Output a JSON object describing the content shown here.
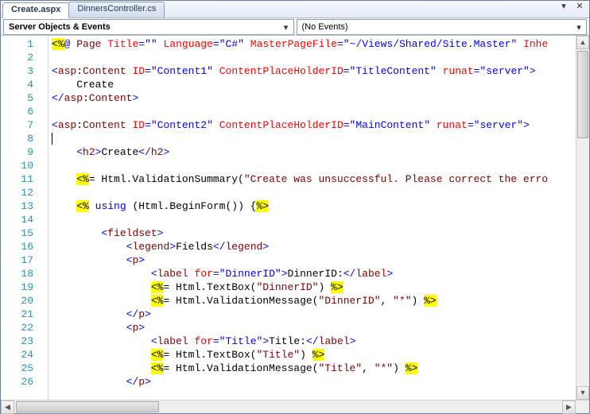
{
  "tabs": {
    "active": "Create.aspx",
    "inactive": "DinnersController.cs"
  },
  "window_controls": {
    "dropdown": "▾",
    "close": "✕"
  },
  "toolbar": {
    "left": {
      "label": "Server Objects & Events",
      "arrow": "▾"
    },
    "right": {
      "label": "(No Events)",
      "arrow": "▾"
    }
  },
  "line_start": 1,
  "line_end": 26,
  "code_lines": [
    [
      [
        "hl",
        "<%"
      ],
      [
        "kw",
        "@ "
      ],
      [
        "tag",
        "Page"
      ],
      [
        "txt",
        " "
      ],
      [
        "attr",
        "Title"
      ],
      [
        "delim",
        "=\""
      ],
      [
        "str",
        ""
      ],
      [
        "delim",
        "\""
      ],
      [
        "txt",
        " "
      ],
      [
        "attr",
        "Language"
      ],
      [
        "delim",
        "=\""
      ],
      [
        "str",
        "C#"
      ],
      [
        "delim",
        "\""
      ],
      [
        "txt",
        " "
      ],
      [
        "attr",
        "MasterPageFile"
      ],
      [
        "delim",
        "=\""
      ],
      [
        "str",
        "~/Views/Shared/Site.Master"
      ],
      [
        "delim",
        "\""
      ],
      [
        "txt",
        " "
      ],
      [
        "attr",
        "Inhe"
      ]
    ],
    [],
    [
      [
        "delim",
        "<"
      ],
      [
        "tag",
        "asp"
      ],
      [
        "txt",
        ":"
      ],
      [
        "tag",
        "Content"
      ],
      [
        "txt",
        " "
      ],
      [
        "attr",
        "ID"
      ],
      [
        "delim",
        "=\""
      ],
      [
        "str",
        "Content1"
      ],
      [
        "delim",
        "\""
      ],
      [
        "txt",
        " "
      ],
      [
        "attr",
        "ContentPlaceHolderID"
      ],
      [
        "delim",
        "=\""
      ],
      [
        "str",
        "TitleContent"
      ],
      [
        "delim",
        "\""
      ],
      [
        "txt",
        " "
      ],
      [
        "attr",
        "runat"
      ],
      [
        "delim",
        "=\""
      ],
      [
        "str",
        "server"
      ],
      [
        "delim",
        "\""
      ],
      [
        "delim",
        ">"
      ]
    ],
    [
      [
        "txt",
        "    Create"
      ]
    ],
    [
      [
        "delim",
        "</"
      ],
      [
        "tag",
        "asp"
      ],
      [
        "txt",
        ":"
      ],
      [
        "tag",
        "Content"
      ],
      [
        "delim",
        ">"
      ]
    ],
    [],
    [
      [
        "delim",
        "<"
      ],
      [
        "tag",
        "asp"
      ],
      [
        "txt",
        ":"
      ],
      [
        "tag",
        "Content"
      ],
      [
        "txt",
        " "
      ],
      [
        "attr",
        "ID"
      ],
      [
        "delim",
        "=\""
      ],
      [
        "str",
        "Content2"
      ],
      [
        "delim",
        "\""
      ],
      [
        "txt",
        " "
      ],
      [
        "attr",
        "ContentPlaceHolderID"
      ],
      [
        "delim",
        "=\""
      ],
      [
        "str",
        "MainContent"
      ],
      [
        "delim",
        "\""
      ],
      [
        "txt",
        " "
      ],
      [
        "attr",
        "runat"
      ],
      [
        "delim",
        "=\""
      ],
      [
        "str",
        "server"
      ],
      [
        "delim",
        "\""
      ],
      [
        "delim",
        ">"
      ]
    ],
    [
      [
        "caret",
        ""
      ]
    ],
    [
      [
        "txt",
        "    "
      ],
      [
        "delim",
        "<"
      ],
      [
        "tag",
        "h2"
      ],
      [
        "delim",
        ">"
      ],
      [
        "txt",
        "Create"
      ],
      [
        "delim",
        "</"
      ],
      [
        "tag",
        "h2"
      ],
      [
        "delim",
        ">"
      ]
    ],
    [],
    [
      [
        "txt",
        "    "
      ],
      [
        "hl",
        "<%"
      ],
      [
        "txt",
        "= Html.ValidationSummary("
      ],
      [
        "tag",
        "\"Create was unsuccessful. Please correct the erro"
      ]
    ],
    [],
    [
      [
        "txt",
        "    "
      ],
      [
        "hl",
        "<%"
      ],
      [
        "txt",
        " "
      ],
      [
        "kw",
        "using"
      ],
      [
        "txt",
        " (Html.BeginForm()) {"
      ],
      [
        "hl",
        "%>"
      ]
    ],
    [],
    [
      [
        "txt",
        "        "
      ],
      [
        "delim",
        "<"
      ],
      [
        "tag",
        "fieldset"
      ],
      [
        "delim",
        ">"
      ]
    ],
    [
      [
        "txt",
        "            "
      ],
      [
        "delim",
        "<"
      ],
      [
        "tag",
        "legend"
      ],
      [
        "delim",
        ">"
      ],
      [
        "txt",
        "Fields"
      ],
      [
        "delim",
        "</"
      ],
      [
        "tag",
        "legend"
      ],
      [
        "delim",
        ">"
      ]
    ],
    [
      [
        "txt",
        "            "
      ],
      [
        "delim",
        "<"
      ],
      [
        "tag",
        "p"
      ],
      [
        "delim",
        ">"
      ]
    ],
    [
      [
        "txt",
        "                "
      ],
      [
        "delim",
        "<"
      ],
      [
        "tag",
        "label"
      ],
      [
        "txt",
        " "
      ],
      [
        "attr",
        "for"
      ],
      [
        "delim",
        "=\""
      ],
      [
        "str",
        "DinnerID"
      ],
      [
        "delim",
        "\""
      ],
      [
        "delim",
        ">"
      ],
      [
        "txt",
        "DinnerID:"
      ],
      [
        "delim",
        "</"
      ],
      [
        "tag",
        "label"
      ],
      [
        "delim",
        ">"
      ]
    ],
    [
      [
        "txt",
        "                "
      ],
      [
        "hl",
        "<%"
      ],
      [
        "txt",
        "= Html.TextBox("
      ],
      [
        "tag",
        "\"DinnerID\""
      ],
      [
        "txt",
        ") "
      ],
      [
        "hl",
        "%>"
      ]
    ],
    [
      [
        "txt",
        "                "
      ],
      [
        "hl",
        "<%"
      ],
      [
        "txt",
        "= Html.ValidationMessage("
      ],
      [
        "tag",
        "\"DinnerID\""
      ],
      [
        "txt",
        ", "
      ],
      [
        "tag",
        "\"*\""
      ],
      [
        "txt",
        ") "
      ],
      [
        "hl",
        "%>"
      ]
    ],
    [
      [
        "txt",
        "            "
      ],
      [
        "delim",
        "</"
      ],
      [
        "tag",
        "p"
      ],
      [
        "delim",
        ">"
      ]
    ],
    [
      [
        "txt",
        "            "
      ],
      [
        "delim",
        "<"
      ],
      [
        "tag",
        "p"
      ],
      [
        "delim",
        ">"
      ]
    ],
    [
      [
        "txt",
        "                "
      ],
      [
        "delim",
        "<"
      ],
      [
        "tag",
        "label"
      ],
      [
        "txt",
        " "
      ],
      [
        "attr",
        "for"
      ],
      [
        "delim",
        "=\""
      ],
      [
        "str",
        "Title"
      ],
      [
        "delim",
        "\""
      ],
      [
        "delim",
        ">"
      ],
      [
        "txt",
        "Title:"
      ],
      [
        "delim",
        "</"
      ],
      [
        "tag",
        "label"
      ],
      [
        "delim",
        ">"
      ]
    ],
    [
      [
        "txt",
        "                "
      ],
      [
        "hl",
        "<%"
      ],
      [
        "txt",
        "= Html.TextBox("
      ],
      [
        "tag",
        "\"Title\""
      ],
      [
        "txt",
        ") "
      ],
      [
        "hl",
        "%>"
      ]
    ],
    [
      [
        "txt",
        "                "
      ],
      [
        "hl",
        "<%"
      ],
      [
        "txt",
        "= Html.ValidationMessage("
      ],
      [
        "tag",
        "\"Title\""
      ],
      [
        "txt",
        ", "
      ],
      [
        "tag",
        "\"*\""
      ],
      [
        "txt",
        ") "
      ],
      [
        "hl",
        "%>"
      ]
    ],
    [
      [
        "txt",
        "            "
      ],
      [
        "delim",
        "</"
      ],
      [
        "tag",
        "p"
      ],
      [
        "delim",
        ">"
      ]
    ]
  ]
}
